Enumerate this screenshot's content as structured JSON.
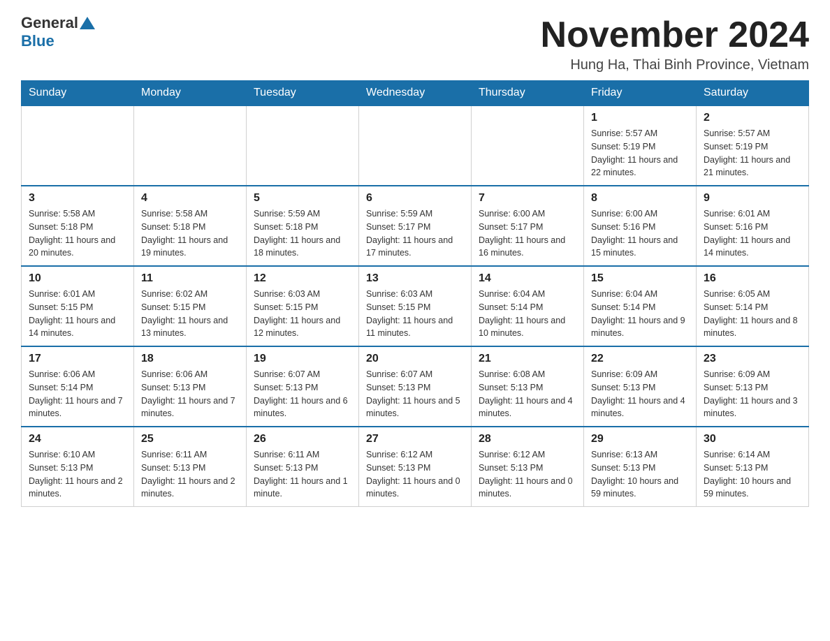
{
  "header": {
    "logo_general": "General",
    "logo_blue": "Blue",
    "title": "November 2024",
    "subtitle": "Hung Ha, Thai Binh Province, Vietnam"
  },
  "weekdays": [
    "Sunday",
    "Monday",
    "Tuesday",
    "Wednesday",
    "Thursday",
    "Friday",
    "Saturday"
  ],
  "weeks": [
    [
      {
        "day": "",
        "info": ""
      },
      {
        "day": "",
        "info": ""
      },
      {
        "day": "",
        "info": ""
      },
      {
        "day": "",
        "info": ""
      },
      {
        "day": "",
        "info": ""
      },
      {
        "day": "1",
        "info": "Sunrise: 5:57 AM\nSunset: 5:19 PM\nDaylight: 11 hours and 22 minutes."
      },
      {
        "day": "2",
        "info": "Sunrise: 5:57 AM\nSunset: 5:19 PM\nDaylight: 11 hours and 21 minutes."
      }
    ],
    [
      {
        "day": "3",
        "info": "Sunrise: 5:58 AM\nSunset: 5:18 PM\nDaylight: 11 hours and 20 minutes."
      },
      {
        "day": "4",
        "info": "Sunrise: 5:58 AM\nSunset: 5:18 PM\nDaylight: 11 hours and 19 minutes."
      },
      {
        "day": "5",
        "info": "Sunrise: 5:59 AM\nSunset: 5:18 PM\nDaylight: 11 hours and 18 minutes."
      },
      {
        "day": "6",
        "info": "Sunrise: 5:59 AM\nSunset: 5:17 PM\nDaylight: 11 hours and 17 minutes."
      },
      {
        "day": "7",
        "info": "Sunrise: 6:00 AM\nSunset: 5:17 PM\nDaylight: 11 hours and 16 minutes."
      },
      {
        "day": "8",
        "info": "Sunrise: 6:00 AM\nSunset: 5:16 PM\nDaylight: 11 hours and 15 minutes."
      },
      {
        "day": "9",
        "info": "Sunrise: 6:01 AM\nSunset: 5:16 PM\nDaylight: 11 hours and 14 minutes."
      }
    ],
    [
      {
        "day": "10",
        "info": "Sunrise: 6:01 AM\nSunset: 5:15 PM\nDaylight: 11 hours and 14 minutes."
      },
      {
        "day": "11",
        "info": "Sunrise: 6:02 AM\nSunset: 5:15 PM\nDaylight: 11 hours and 13 minutes."
      },
      {
        "day": "12",
        "info": "Sunrise: 6:03 AM\nSunset: 5:15 PM\nDaylight: 11 hours and 12 minutes."
      },
      {
        "day": "13",
        "info": "Sunrise: 6:03 AM\nSunset: 5:15 PM\nDaylight: 11 hours and 11 minutes."
      },
      {
        "day": "14",
        "info": "Sunrise: 6:04 AM\nSunset: 5:14 PM\nDaylight: 11 hours and 10 minutes."
      },
      {
        "day": "15",
        "info": "Sunrise: 6:04 AM\nSunset: 5:14 PM\nDaylight: 11 hours and 9 minutes."
      },
      {
        "day": "16",
        "info": "Sunrise: 6:05 AM\nSunset: 5:14 PM\nDaylight: 11 hours and 8 minutes."
      }
    ],
    [
      {
        "day": "17",
        "info": "Sunrise: 6:06 AM\nSunset: 5:14 PM\nDaylight: 11 hours and 7 minutes."
      },
      {
        "day": "18",
        "info": "Sunrise: 6:06 AM\nSunset: 5:13 PM\nDaylight: 11 hours and 7 minutes."
      },
      {
        "day": "19",
        "info": "Sunrise: 6:07 AM\nSunset: 5:13 PM\nDaylight: 11 hours and 6 minutes."
      },
      {
        "day": "20",
        "info": "Sunrise: 6:07 AM\nSunset: 5:13 PM\nDaylight: 11 hours and 5 minutes."
      },
      {
        "day": "21",
        "info": "Sunrise: 6:08 AM\nSunset: 5:13 PM\nDaylight: 11 hours and 4 minutes."
      },
      {
        "day": "22",
        "info": "Sunrise: 6:09 AM\nSunset: 5:13 PM\nDaylight: 11 hours and 4 minutes."
      },
      {
        "day": "23",
        "info": "Sunrise: 6:09 AM\nSunset: 5:13 PM\nDaylight: 11 hours and 3 minutes."
      }
    ],
    [
      {
        "day": "24",
        "info": "Sunrise: 6:10 AM\nSunset: 5:13 PM\nDaylight: 11 hours and 2 minutes."
      },
      {
        "day": "25",
        "info": "Sunrise: 6:11 AM\nSunset: 5:13 PM\nDaylight: 11 hours and 2 minutes."
      },
      {
        "day": "26",
        "info": "Sunrise: 6:11 AM\nSunset: 5:13 PM\nDaylight: 11 hours and 1 minute."
      },
      {
        "day": "27",
        "info": "Sunrise: 6:12 AM\nSunset: 5:13 PM\nDaylight: 11 hours and 0 minutes."
      },
      {
        "day": "28",
        "info": "Sunrise: 6:12 AM\nSunset: 5:13 PM\nDaylight: 11 hours and 0 minutes."
      },
      {
        "day": "29",
        "info": "Sunrise: 6:13 AM\nSunset: 5:13 PM\nDaylight: 10 hours and 59 minutes."
      },
      {
        "day": "30",
        "info": "Sunrise: 6:14 AM\nSunset: 5:13 PM\nDaylight: 10 hours and 59 minutes."
      }
    ]
  ]
}
